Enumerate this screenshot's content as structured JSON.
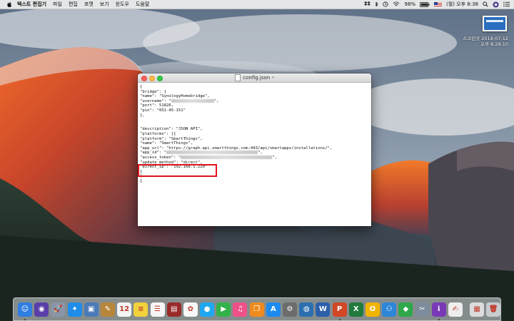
{
  "menubar": {
    "app_name": "텍스트 편집기",
    "menus": [
      "파일",
      "편집",
      "포맷",
      "보기",
      "윈도우",
      "도움말"
    ],
    "battery": "98%",
    "clock": "(월) 오후 8:38"
  },
  "screenshot_thumb": {
    "line1": "스크린샷 2018-07-12",
    "line2": "오후 8.29.10"
  },
  "window": {
    "title": "config.json",
    "lines": [
      "{",
      "\"bridge\": {",
      "\"name\": \"SynologyHomebridge\",",
      "\"username\": \"",
      "\"port\": 51826,",
      "\"pin\": \"031-45-151\"",
      "},",
      "",
      "",
      "\"description\": \"JSON API\",",
      "\"platforms\": [{",
      "\"platform\": \"SmartThings\",",
      "\"name\": \"SmartThings\",",
      "\"app_url\": \"https://graph.api.smartthings.com:443/api/smartapps/installations/\",",
      "\"app_id\": \"",
      "\"access_token\": \"",
      "\"update_method\": \"direct\",",
      "\"direct_ip\": \"192.168.1.220\"",
      "}",
      "]",
      "}"
    ],
    "line_suffixes": {
      "username": "\",",
      "app_id": "\",",
      "access_token": "\","
    }
  },
  "dock": {
    "apps": [
      {
        "name": "finder-icon",
        "glyph": "☺",
        "color": "#2f7ee0"
      },
      {
        "name": "siri-icon",
        "glyph": "◉",
        "color": "#5a3fa8"
      },
      {
        "name": "launchpad-icon",
        "glyph": "🚀",
        "color": "#8a96a8"
      },
      {
        "name": "safari-icon",
        "glyph": "✦",
        "color": "#1f8de8"
      },
      {
        "name": "preview-icon",
        "glyph": "▣",
        "color": "#4a7ab8"
      },
      {
        "name": "notes-icon",
        "glyph": "✎",
        "color": "#b8863a"
      },
      {
        "name": "calendar-icon",
        "glyph": "12",
        "color": "#f4f4f4"
      },
      {
        "name": "stickies-icon",
        "glyph": "≡",
        "color": "#f2d23c"
      },
      {
        "name": "reminders-icon",
        "glyph": "☰",
        "color": "#f6f6f6"
      },
      {
        "name": "photo-booth-icon",
        "glyph": "▤",
        "color": "#9a2a2a"
      },
      {
        "name": "photos-icon",
        "glyph": "✿",
        "color": "#f8f8f8"
      },
      {
        "name": "messages-icon",
        "glyph": "●",
        "color": "#1fa8f0"
      },
      {
        "name": "facetime-icon",
        "glyph": "▶",
        "color": "#33b24a"
      },
      {
        "name": "itunes-icon",
        "glyph": "♫",
        "color": "#f0508a"
      },
      {
        "name": "ibooks-icon",
        "glyph": "❐",
        "color": "#f08a1e"
      },
      {
        "name": "app-store-icon",
        "glyph": "A",
        "color": "#1d8af0"
      },
      {
        "name": "system-preferences-icon",
        "glyph": "⚙",
        "color": "#6c6c6c"
      },
      {
        "name": "globe-icon",
        "glyph": "◍",
        "color": "#2c6fb0"
      },
      {
        "name": "word-icon",
        "glyph": "W",
        "color": "#2b5faa"
      },
      {
        "name": "powerpoint-icon",
        "glyph": "P",
        "color": "#d24726"
      },
      {
        "name": "excel-icon",
        "glyph": "X",
        "color": "#1f7a3c"
      },
      {
        "name": "outlook-icon",
        "glyph": "O",
        "color": "#f2b400"
      },
      {
        "name": "people-icon",
        "glyph": "⚇",
        "color": "#2d86d8"
      },
      {
        "name": "green-app-icon",
        "glyph": "◆",
        "color": "#2ea84a"
      },
      {
        "name": "utilities-icon",
        "glyph": "✂",
        "color": "#7c8c9c"
      },
      {
        "name": "purple-app-icon",
        "glyph": "i",
        "color": "#7a3ab8"
      },
      {
        "name": "document-icon",
        "glyph": "✍",
        "color": "#eeeeee"
      }
    ],
    "right_items": [
      {
        "name": "downloads-stack-icon",
        "glyph": "▦",
        "color": "#dcdcdc"
      },
      {
        "name": "trash-icon",
        "glyph": "🗑",
        "color": "#c8ccd0"
      }
    ]
  }
}
